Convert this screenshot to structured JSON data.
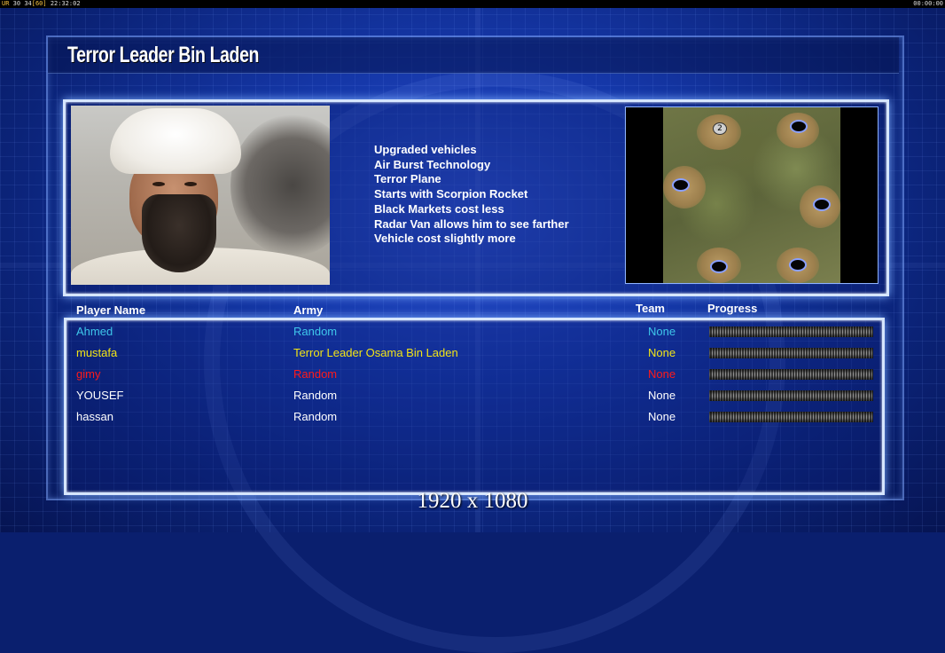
{
  "topbar": {
    "prefix": "UR",
    "fps_a": "30",
    "fps_b": "34",
    "fps_cap": "[60]",
    "clock_left": "22:32:02",
    "clock_right": "00:00:00"
  },
  "screen": {
    "title": "Terror Leader Bin Laden",
    "traits": [
      "Upgraded vehicles",
      "Air Burst Technology",
      "Terror Plane",
      "Starts with Scorpion Rocket",
      "Black Markets cost less",
      "Radar Van allows him to see farther",
      "Vehicle cost slightly more"
    ],
    "map": {
      "start_marker": "2"
    }
  },
  "players": {
    "headers": {
      "name": "Player Name",
      "army": "Army",
      "team": "Team",
      "progress": "Progress"
    },
    "rows": [
      {
        "name": "Ahmed",
        "army": "Random",
        "team": "None",
        "color": "#3ec6ea"
      },
      {
        "name": "mustafa",
        "army": "Terror Leader Osama Bin Laden",
        "team": "None",
        "color": "#f2e416"
      },
      {
        "name": "gimy",
        "army": "Random",
        "team": "None",
        "color": "#ff1a1a"
      },
      {
        "name": "YOUSEF",
        "army": "Random",
        "team": "None",
        "color": "#ffffff"
      },
      {
        "name": "hassan",
        "army": "Random",
        "team": "None",
        "color": "#ffffff"
      }
    ]
  },
  "footer": {
    "resolution": "1920 x 1080"
  }
}
